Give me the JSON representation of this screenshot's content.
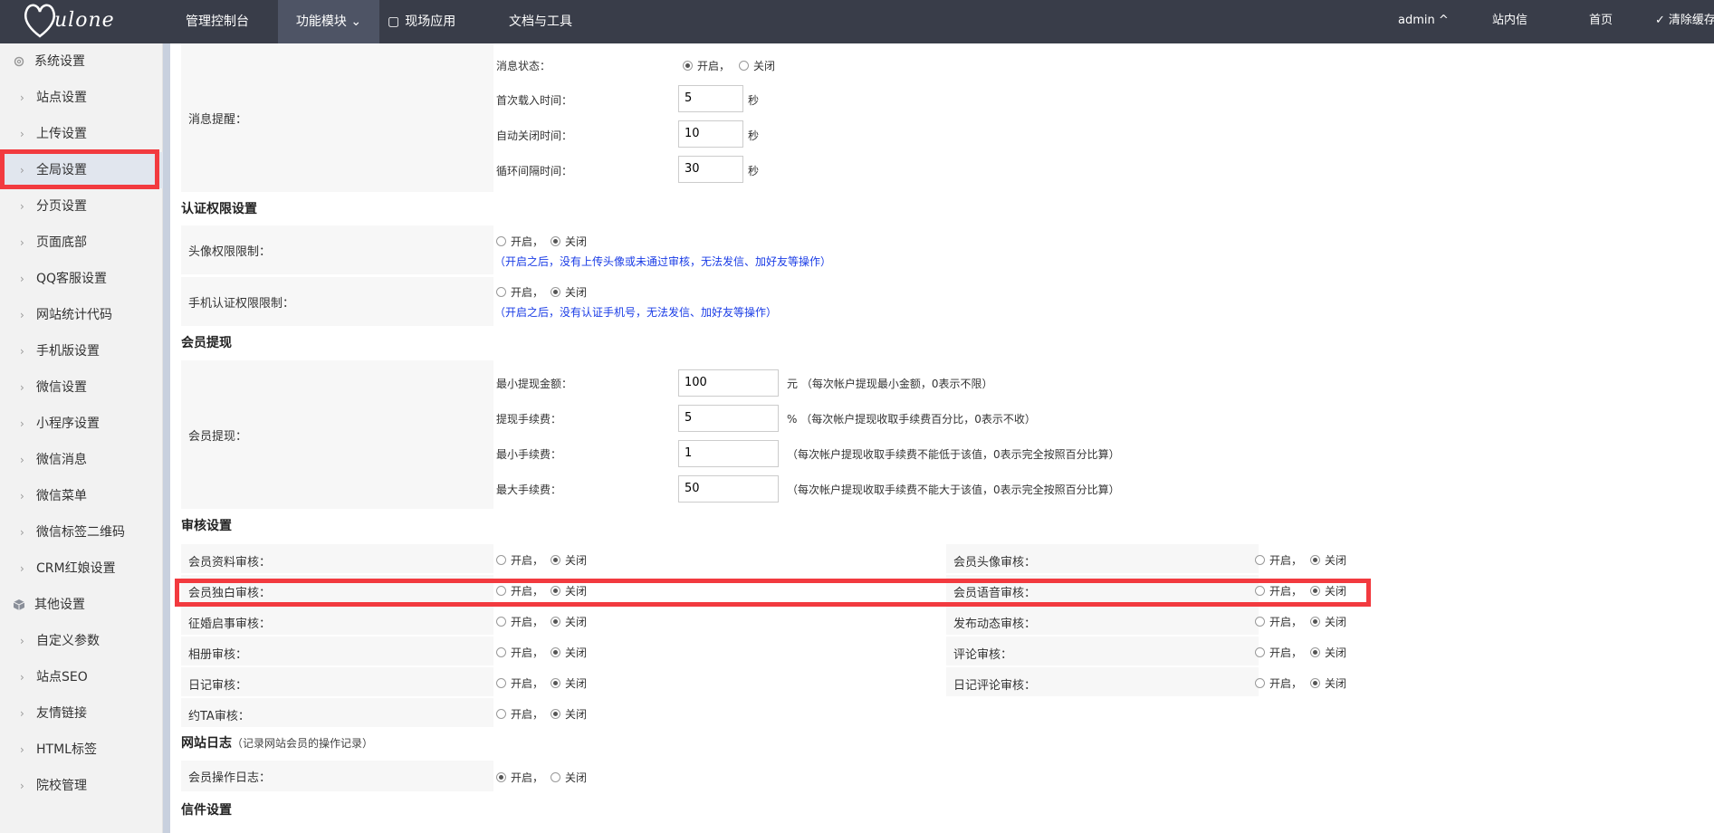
{
  "brand": {
    "logo_text": "ulone"
  },
  "topnav": {
    "items": [
      "管理控制台",
      "功能模块",
      "现场应用",
      "文档与工具"
    ],
    "user": "admin ^",
    "inbox": "站内信",
    "home": "首页",
    "clear_cache": "清除缓存"
  },
  "sidebar": {
    "group1": "系统设置",
    "group1_items": [
      "站点设置",
      "上传设置",
      "全局设置",
      "分页设置",
      "页面底部",
      "QQ客服设置",
      "网站统计代码",
      "手机版设置",
      "微信设置",
      "小程序设置",
      "微信消息",
      "微信菜单",
      "微信标签二维码",
      "CRM红娘设置"
    ],
    "group2": "其他设置",
    "group2_items": [
      "自定义参数",
      "站点SEO",
      "友情链接",
      "HTML标签",
      "院校管理"
    ],
    "active": "全局设置"
  },
  "radio": {
    "on": "开启，",
    "off": "关闭"
  },
  "message": {
    "label": "消息提醒：",
    "status_label": "消息状态：",
    "first_load_label": "首次载入时间：",
    "first_load_value": "5",
    "auto_close_label": "自动关闭时间：",
    "auto_close_value": "10",
    "interval_label": "循环间隔时间：",
    "interval_value": "30",
    "unit_sec": "秒"
  },
  "auth": {
    "title": "认证权限设置",
    "avatar_label": "头像权限限制：",
    "avatar_hint": "（开启之后，没有上传头像或未通过审核，无法发信、加好友等操作）",
    "phone_label": "手机认证权限限制：",
    "phone_hint": "（开启之后，没有认证手机号，无法发信、加好友等操作）"
  },
  "withdraw": {
    "title": "会员提现",
    "label": "会员提现：",
    "min_amount_label": "最小提现金额：",
    "min_amount_value": "100",
    "min_amount_unit": "元 （每次帐户提现最小金额，0表示不限）",
    "fee_label": "提现手续费：",
    "fee_value": "5",
    "fee_unit": "% （每次帐户提现收取手续费百分比，0表示不收）",
    "min_fee_label": "最小手续费：",
    "min_fee_value": "1",
    "min_fee_unit": "（每次帐户提现收取手续费不能低于该值，0表示完全按照百分比算）",
    "max_fee_label": "最大手续费：",
    "max_fee_value": "50",
    "max_fee_unit": "（每次帐户提现收取手续费不能大于该值，0表示完全按照百分比算）"
  },
  "review": {
    "title": "审核设置",
    "left": [
      "会员资料审核：",
      "会员独白审核：",
      "征婚启事审核：",
      "相册审核：",
      "日记审核：",
      "约TA审核："
    ],
    "right": [
      "会员头像审核：",
      "会员语音审核：",
      "发布动态审核：",
      "评论审核：",
      "日记评论审核："
    ]
  },
  "log": {
    "title": "网站日志",
    "note": "（记录网站会员的操作记录）",
    "label": "会员操作日志："
  },
  "mail": {
    "title": "信件设置"
  }
}
